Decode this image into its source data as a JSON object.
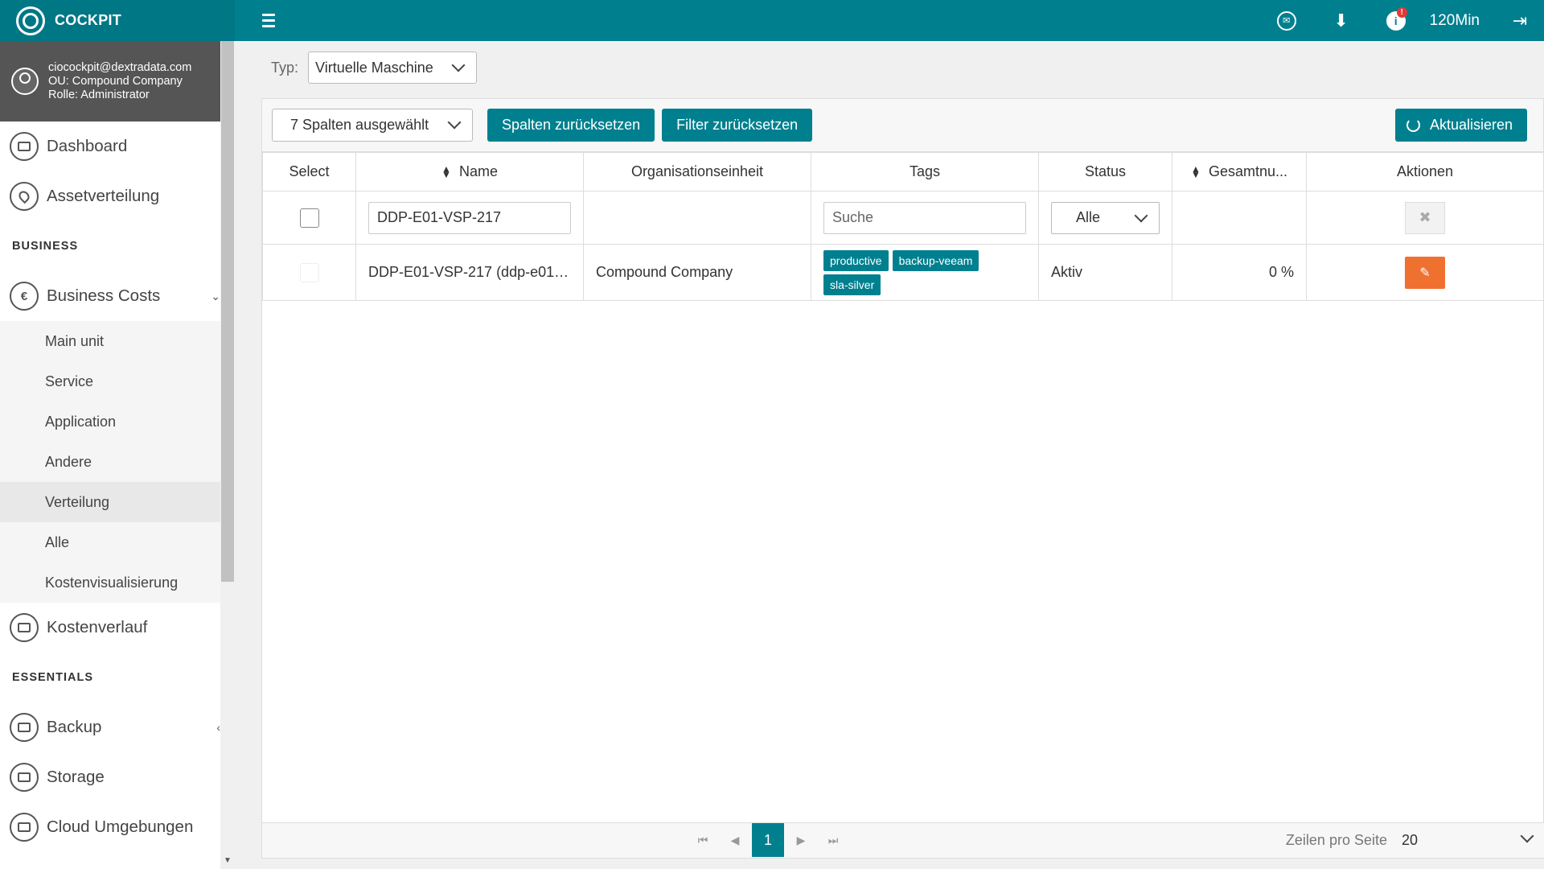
{
  "brand": {
    "name": "COCKPIT"
  },
  "topbar": {
    "session_time": "120Min",
    "info_badge": "!"
  },
  "user": {
    "email": "ciocockpit@dextradata.com",
    "ou": "OU: Compound Company",
    "role": "Rolle: Administrator"
  },
  "sidebar": {
    "dashboard": "Dashboard",
    "assetverteilung": "Assetverteilung",
    "section_business": "BUSINESS",
    "business_costs": "Business Costs",
    "sub_items": [
      "Main unit",
      "Service",
      "Application",
      "Andere",
      "Verteilung",
      "Alle",
      "Kostenvisualisierung"
    ],
    "active_sub": "Verteilung",
    "kostenverlauf": "Kostenverlauf",
    "section_essentials": "ESSENTIALS",
    "backup": "Backup",
    "storage": "Storage",
    "cloud": "Cloud Umgebungen"
  },
  "main": {
    "typ_label": "Typ:",
    "typ_value": "Virtuelle Maschine",
    "columns_selected": "7 Spalten ausgewählt",
    "reset_columns": "Spalten zurücksetzen",
    "reset_filter": "Filter zurücksetzen",
    "refresh": "Aktualisieren"
  },
  "table": {
    "headers": [
      "Select",
      "Name",
      "Organisationseinheit",
      "Tags",
      "Status",
      "Gesamtnu...",
      "Aktionen"
    ],
    "filters": {
      "name": "DDP-E01-VSP-217",
      "tags_placeholder": "Suche",
      "status": "Alle"
    },
    "rows": [
      {
        "name": "DDP-E01-VSP-217 (ddp-e01-v...",
        "org": "Compound Company",
        "tags": [
          "productive",
          "backup-veeam",
          "sla-silver"
        ],
        "status": "Aktiv",
        "usage": "0 %"
      }
    ]
  },
  "pager": {
    "current_page": "1",
    "rows_per_page_label": "Zeilen pro Seite",
    "rows_per_page": "20"
  }
}
